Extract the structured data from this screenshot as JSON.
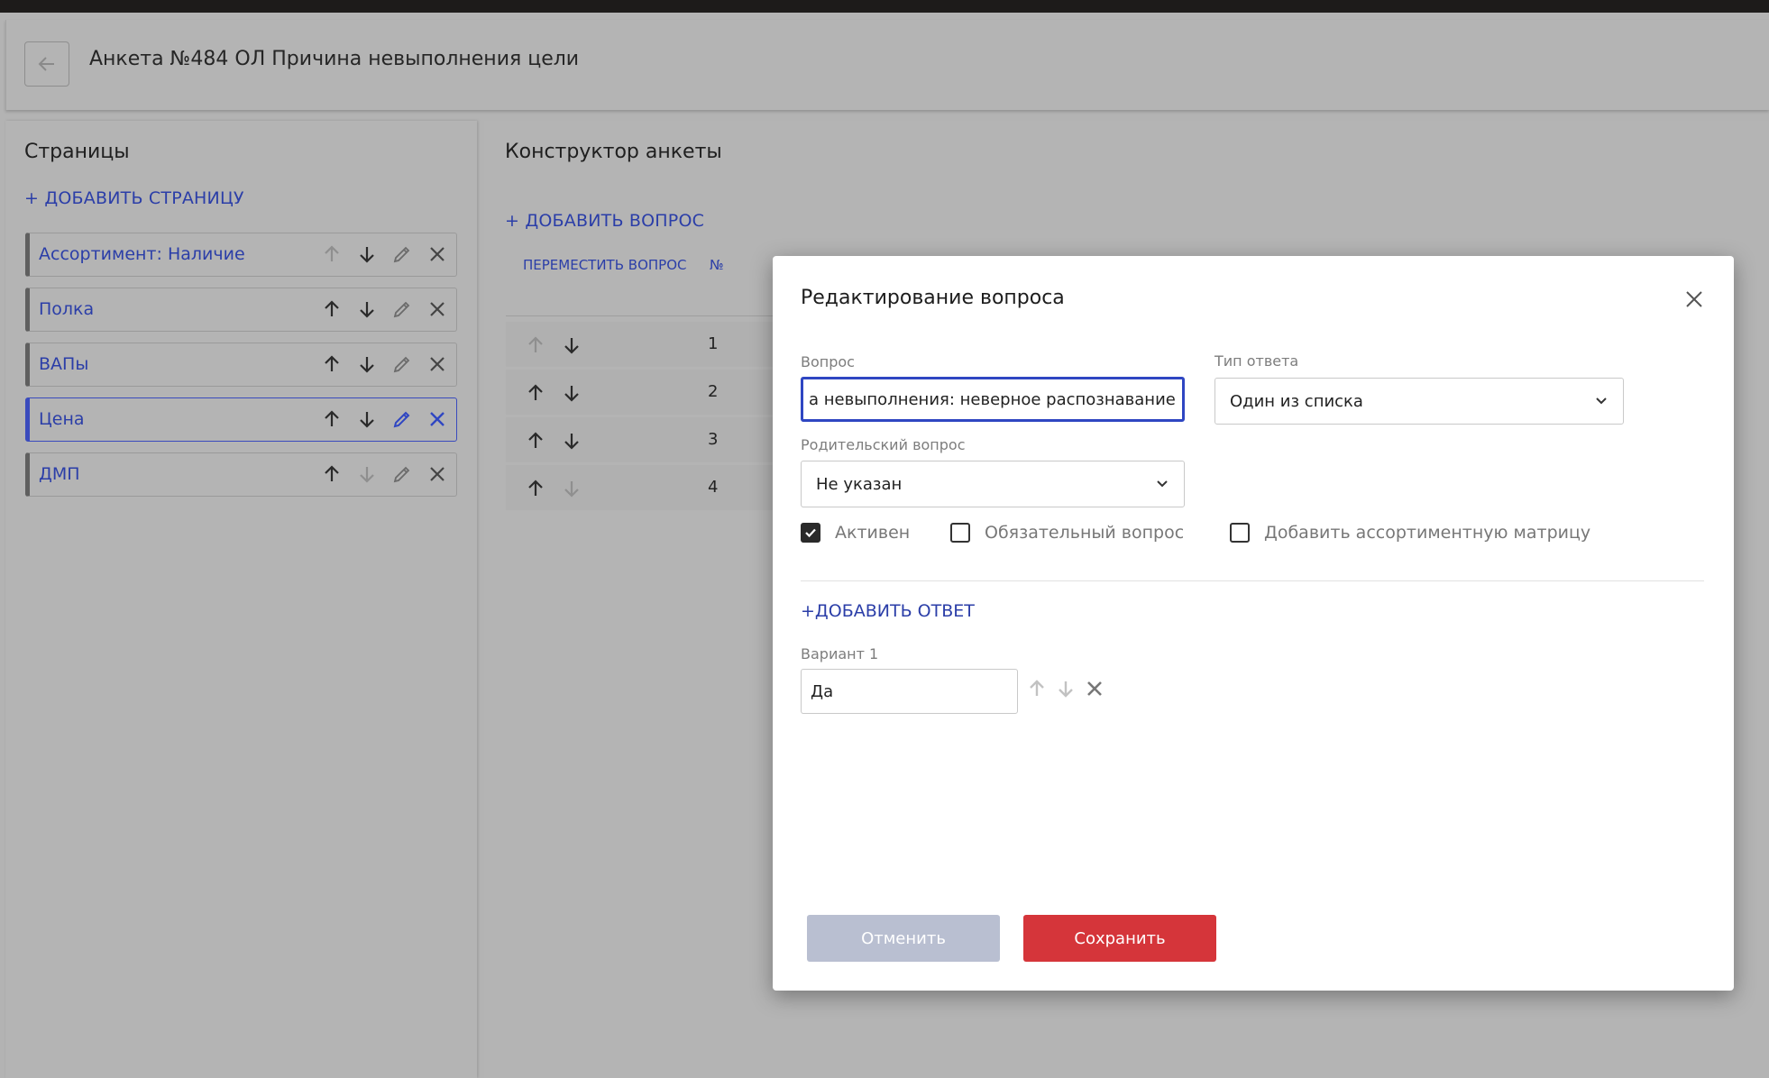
{
  "header": {
    "title": "Анкета №484 ОЛ Причина невыполнения цели"
  },
  "pages_panel": {
    "title": "Страницы",
    "add_page_label": "+ ДОБАВИТЬ СТРАНИЦУ",
    "items": [
      {
        "label": "Ассортимент: Наличие"
      },
      {
        "label": "Полка"
      },
      {
        "label": "ВАПы"
      },
      {
        "label": "Цена"
      },
      {
        "label": "ДМП"
      }
    ]
  },
  "builder_panel": {
    "title": "Конструктор анкеты",
    "add_question_label": "+ ДОБАВИТЬ ВОПРОС",
    "col_move": "ПЕРЕМЕСТИТЬ ВОПРОС",
    "col_num": "№",
    "rows": [
      {
        "num": "1"
      },
      {
        "num": "2"
      },
      {
        "num": "3"
      },
      {
        "num": "4"
      }
    ]
  },
  "modal": {
    "title": "Редактирование вопроса",
    "question_label": "Вопрос",
    "question_value": "а невыполнения: неверное распознавание",
    "answer_type_label": "Тип ответа",
    "answer_type_value": "Один из списка",
    "parent_label": "Родительский вопрос",
    "parent_value": "Не указан",
    "checkbox_active": "Активен",
    "checkbox_required": "Обязательный вопрос",
    "checkbox_matrix": "Добавить ассортиментную матрицу",
    "add_answer_label": "+ДОБАВИТЬ ОТВЕТ",
    "variant_label": "Вариант 1",
    "variant_value": "Да",
    "cancel_label": "Отменить",
    "save_label": "Сохранить"
  },
  "colors": {
    "accent": "#2b3ea8",
    "save": "#d5353a",
    "cancel": "#b9bfd1"
  }
}
